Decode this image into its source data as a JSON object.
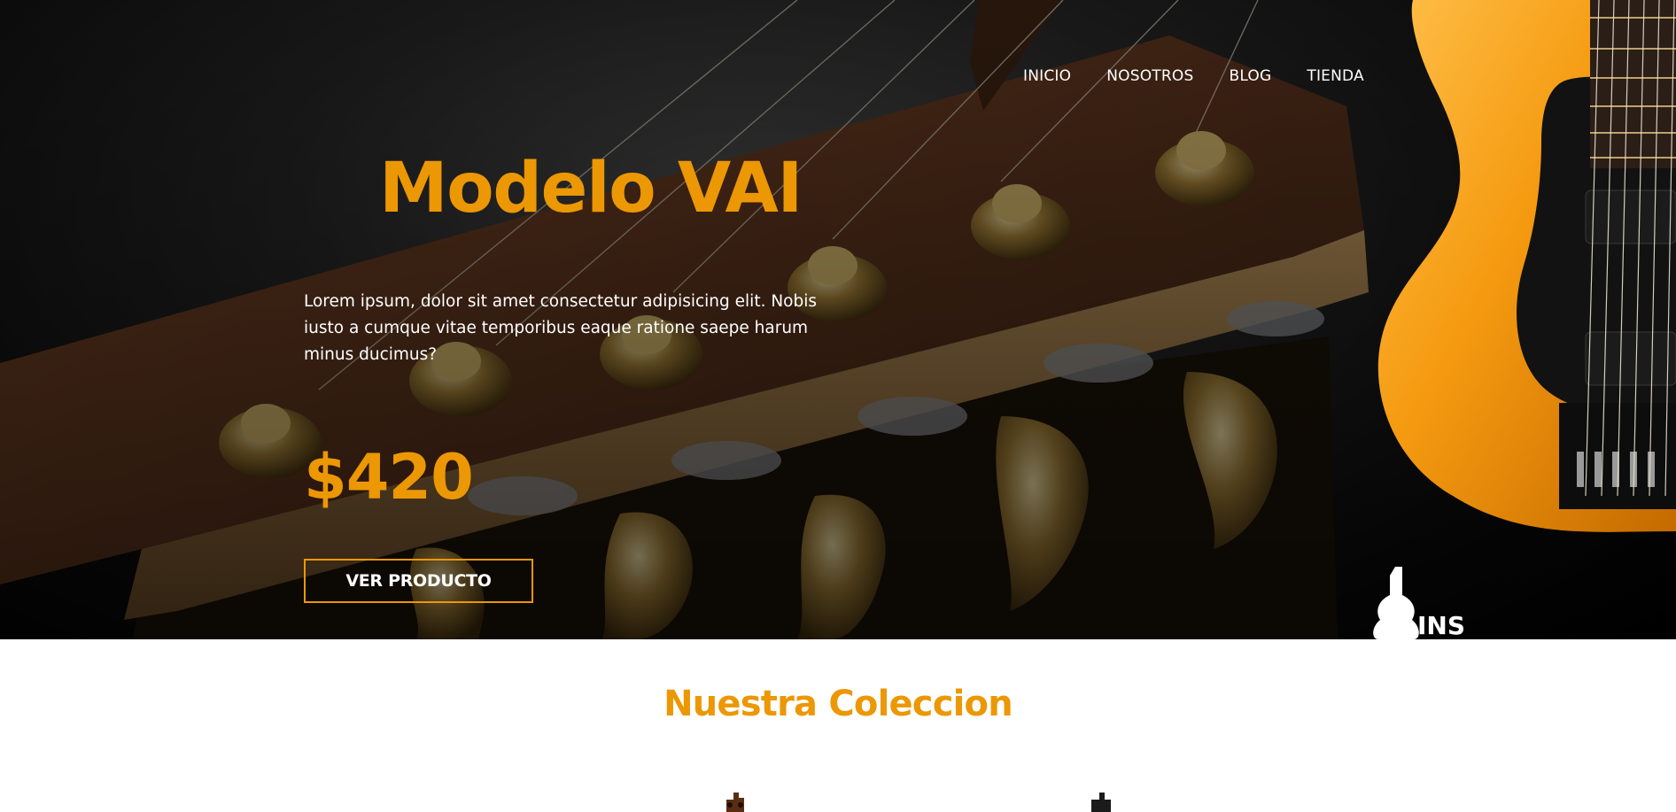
{
  "nav": {
    "items": [
      {
        "label": "INICIO"
      },
      {
        "label": "NOSOTROS"
      },
      {
        "label": "BLOG"
      },
      {
        "label": "TIENDA"
      }
    ]
  },
  "hero": {
    "title": "Modelo VAI",
    "description": "Lorem ipsum, dolor sit amet consectetur adipisicing elit. Nobis iusto a cumque vitae temporibus eaque ratione saepe harum minus ducimus?",
    "price": "$420",
    "cta_label": "VER PRODUCTO",
    "brand_text": "INS"
  },
  "collection": {
    "title": "Nuestra Coleccion",
    "items": [
      {
        "icon": "guitar-headstock-icon"
      },
      {
        "icon": "guitar-headstock-icon"
      }
    ]
  },
  "colors": {
    "accent": "#ec9704",
    "hero_text": "#ffffff",
    "page_bg": "#ffffff"
  }
}
